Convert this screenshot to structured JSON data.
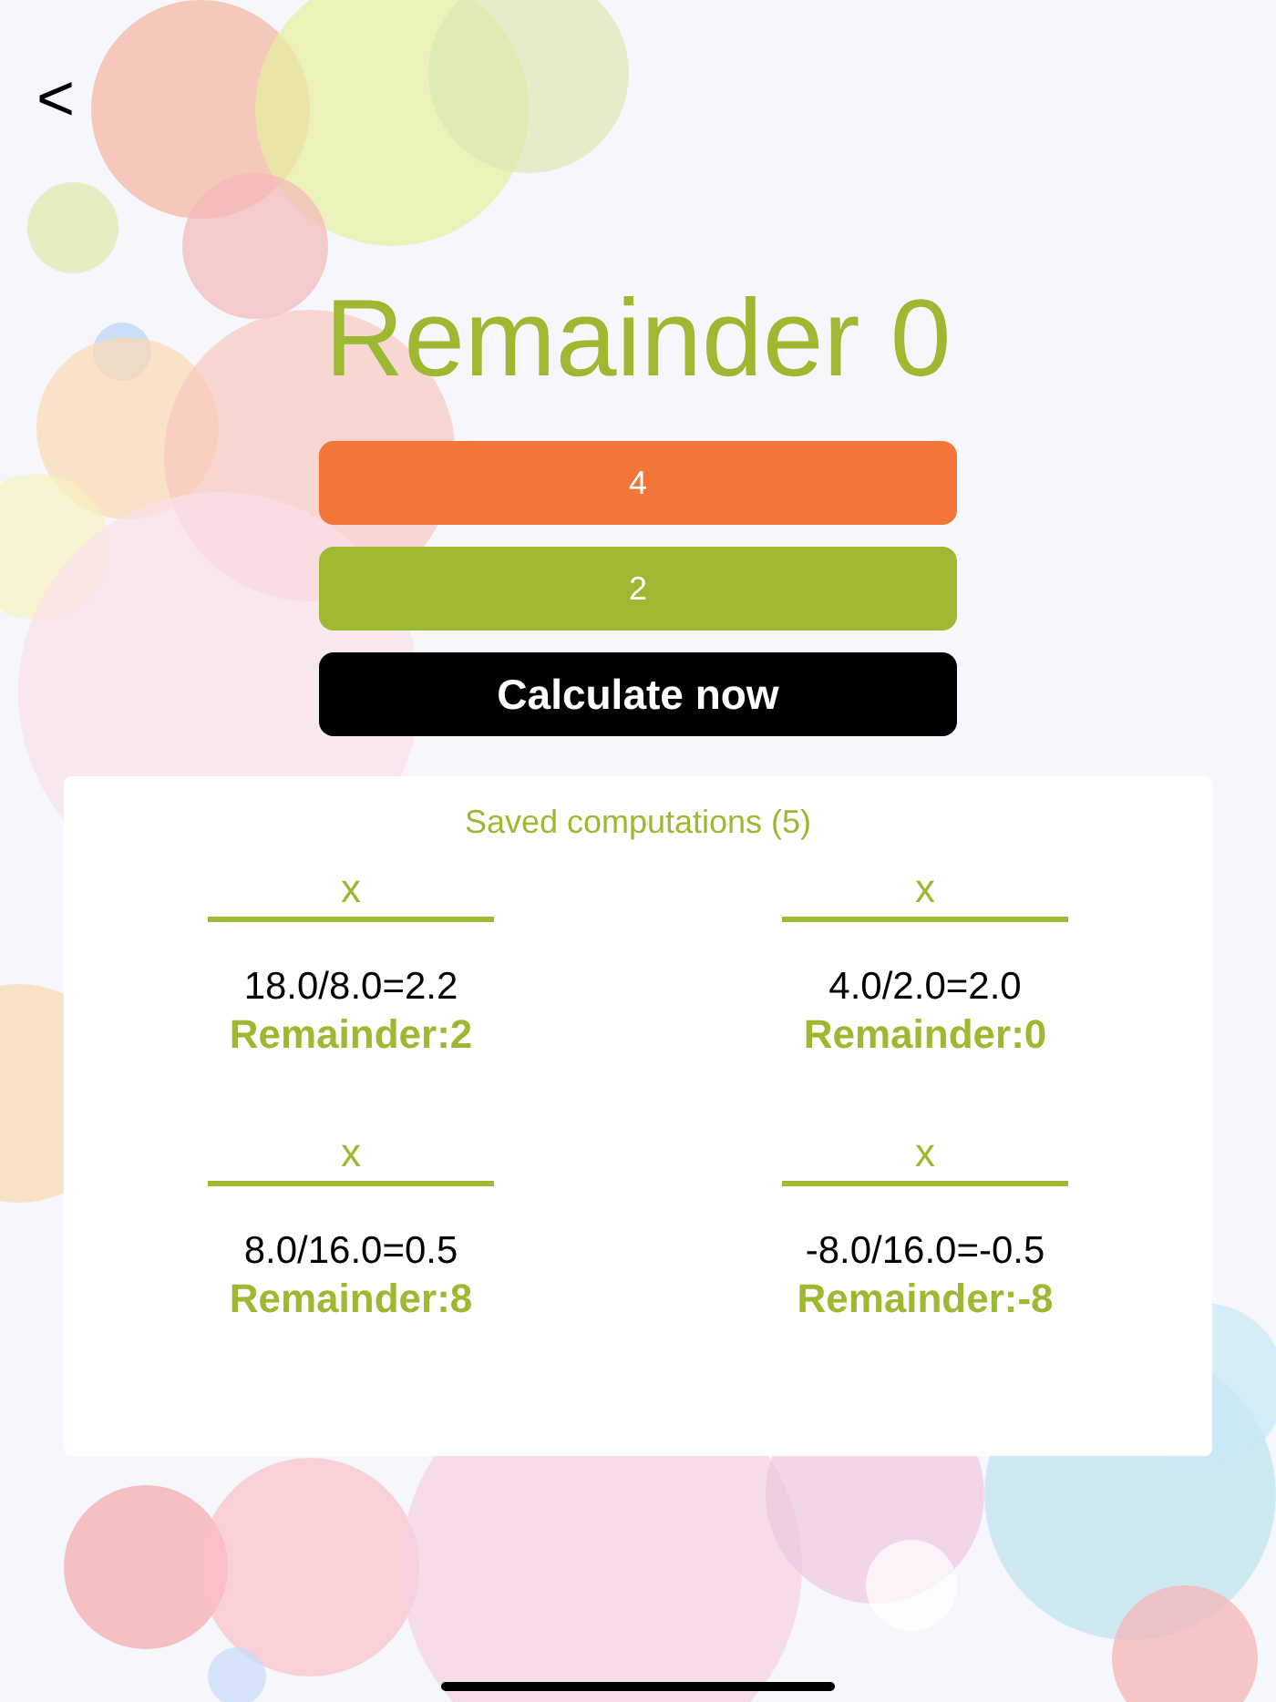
{
  "back": {
    "glyph": "<"
  },
  "title": "Remainder 0",
  "fields": [
    {
      "kind": "dividend",
      "value": "4"
    },
    {
      "kind": "divisor",
      "value": "2"
    }
  ],
  "calculate_button": "Calculate now",
  "saved": {
    "heading": "Saved computations (5)",
    "items": [
      {
        "delete": "x",
        "equation": "18.0/8.0=2.2",
        "remainder": "Remainder:2"
      },
      {
        "delete": "x",
        "equation": "4.0/2.0=2.0",
        "remainder": "Remainder:0"
      },
      {
        "delete": "x",
        "equation": "8.0/16.0=0.5",
        "remainder": "Remainder:8"
      },
      {
        "delete": "x",
        "equation": "-8.0/16.0=-0.5",
        "remainder": "Remainder:-8"
      }
    ]
  }
}
